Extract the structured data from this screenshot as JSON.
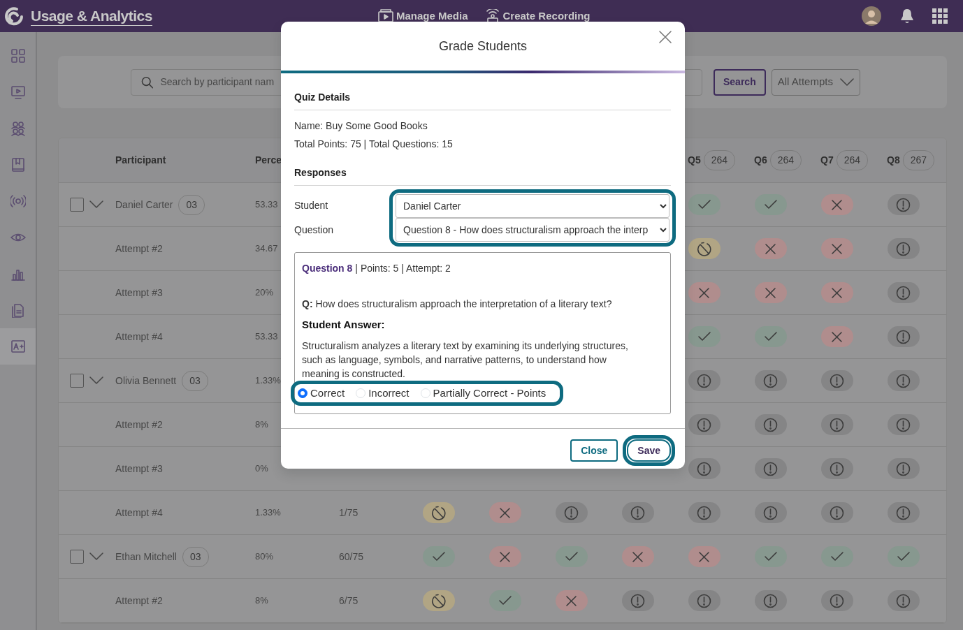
{
  "header": {
    "title": "Usage & Analytics",
    "nav": [
      {
        "label": "Manage Media",
        "kind": "media"
      },
      {
        "label": "Create Recording",
        "kind": "recording"
      }
    ]
  },
  "sidebar": {
    "items": [
      {
        "kind": "dashboard",
        "selected": false
      },
      {
        "kind": "media",
        "selected": false
      },
      {
        "kind": "users",
        "selected": false
      },
      {
        "kind": "book",
        "selected": false
      },
      {
        "kind": "live",
        "selected": false
      },
      {
        "kind": "view",
        "selected": false
      },
      {
        "kind": "chart",
        "selected": false
      },
      {
        "kind": "document",
        "selected": false
      },
      {
        "kind": "grades",
        "selected": true
      }
    ]
  },
  "search": {
    "placeholder": "Search by participant nam",
    "button": "Search",
    "filter": "All Attempts"
  },
  "table": {
    "columns": {
      "participant": "Participant",
      "percentage": "Perce",
      "questions": [
        {
          "label": "Q5",
          "count": "264"
        },
        {
          "label": "Q6",
          "count": "264"
        },
        {
          "label": "Q7",
          "count": "264"
        },
        {
          "label": "Q8",
          "count": "267"
        }
      ]
    },
    "rows": [
      {
        "kind": "participant",
        "name": "Daniel Carter",
        "attempts": "03",
        "checked": false,
        "percentage": "53.33",
        "answers": [
          {
            "kind": "correct"
          },
          {
            "kind": "correct"
          },
          {
            "kind": "incorrect"
          },
          {
            "kind": "unanswered"
          }
        ]
      },
      {
        "kind": "attempt",
        "name": "Attempt #2",
        "percentage": "34.67",
        "answers": [
          {
            "kind": "pending"
          },
          {
            "kind": "incorrect"
          },
          {
            "kind": "incorrect"
          },
          {
            "kind": "unanswered"
          }
        ]
      },
      {
        "kind": "attempt",
        "name": "Attempt #3",
        "percentage": "20%",
        "answers": [
          {
            "kind": "incorrect"
          },
          {
            "kind": "incorrect"
          },
          {
            "kind": "incorrect"
          },
          {
            "kind": "unanswered"
          }
        ]
      },
      {
        "kind": "attempt",
        "name": "Attempt #4",
        "percentage": "53.33",
        "answers": [
          {
            "kind": "correct"
          },
          {
            "kind": "correct"
          },
          {
            "kind": "incorrect"
          },
          {
            "kind": "unanswered"
          }
        ]
      },
      {
        "kind": "participant",
        "name": "Olivia Bennett",
        "attempts": "03",
        "checked": false,
        "percentage": "1.33%",
        "answers": [
          {
            "kind": "unanswered"
          },
          {
            "kind": "unanswered"
          },
          {
            "kind": "unanswered"
          },
          {
            "kind": "unanswered"
          }
        ]
      },
      {
        "kind": "attempt",
        "name": "Attempt #2",
        "percentage": "8%",
        "answers": [
          {
            "kind": "unanswered"
          },
          {
            "kind": "unanswered"
          },
          {
            "kind": "unanswered"
          },
          {
            "kind": "unanswered"
          }
        ]
      },
      {
        "kind": "attempt",
        "name": "Attempt #3",
        "percentage": "0%",
        "answers": [
          {
            "kind": "unanswered"
          },
          {
            "kind": "unanswered"
          },
          {
            "kind": "unanswered"
          },
          {
            "kind": "unanswered"
          }
        ]
      },
      {
        "kind": "attempt",
        "name": "Attempt #4",
        "percentage": "1.33%",
        "score": "1/75",
        "answers": [
          {
            "kind": "pending"
          },
          {
            "kind": "incorrect"
          },
          {
            "kind": "unanswered"
          },
          {
            "kind": "unanswered"
          },
          {
            "kind": "unanswered"
          },
          {
            "kind": "unanswered"
          },
          {
            "kind": "unanswered"
          },
          {
            "kind": "unanswered"
          }
        ]
      },
      {
        "kind": "participant",
        "name": "Ethan Mitchell",
        "attempts": "03",
        "checked": false,
        "percentage": "80%",
        "score": "60/75",
        "answers": [
          {
            "kind": "correct"
          },
          {
            "kind": "incorrect"
          },
          {
            "kind": "correct"
          },
          {
            "kind": "incorrect"
          },
          {
            "kind": "incorrect"
          },
          {
            "kind": "correct"
          },
          {
            "kind": "correct"
          },
          {
            "kind": "correct"
          }
        ]
      },
      {
        "kind": "attempt",
        "name": "Attempt #2",
        "percentage": "8%",
        "score": "6/75",
        "answers": [
          {
            "kind": "pending"
          },
          {
            "kind": "correct"
          },
          {
            "kind": "incorrect"
          },
          {
            "kind": "unanswered"
          },
          {
            "kind": "unanswered"
          },
          {
            "kind": "unanswered"
          },
          {
            "kind": "unanswered"
          },
          {
            "kind": "unanswered"
          }
        ]
      }
    ]
  },
  "modal": {
    "title": "Grade Students",
    "quiz_section": "Quiz Details",
    "name_line": "Name: Buy Some Good Books",
    "totals": "Total Points: 75 | Total Questions: 15",
    "responses_section": "Responses",
    "student_label": "Student",
    "student_value": "Daniel Carter",
    "question_label": "Question",
    "question_value": "Question 8 - How does structuralism approach the interp",
    "selects_highlighted": true,
    "question_link": "Question 8",
    "question_meta": "| Points: 5 | Attempt: 2",
    "prompt": "**Q:** How does structuralism approach the interpretation of a literary text?",
    "answer_heading": "Student Answer:",
    "answer": "Structuralism analyzes a literary text by examining its underlying structures, such as language, symbols, and narrative patterns, to understand how meaning is constructed.",
    "grades_highlighted": true,
    "grades": [
      {
        "label": "Correct",
        "selected": true
      },
      {
        "label": "Incorrect",
        "selected": false
      },
      {
        "label": "Partially Correct - Points",
        "selected": false
      }
    ],
    "buttons": [
      {
        "label": "Close",
        "kind": "secondary",
        "highlighted": false
      },
      {
        "label": "Save",
        "kind": "primary",
        "highlighted": true
      }
    ]
  }
}
